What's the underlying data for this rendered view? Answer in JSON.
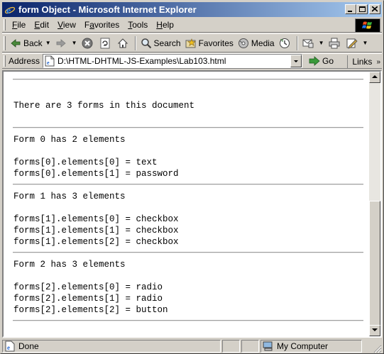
{
  "window": {
    "title": "form Object - Microsoft Internet Explorer"
  },
  "menu": {
    "items": [
      {
        "label": "File",
        "key": "F",
        "rest": "ile"
      },
      {
        "label": "Edit",
        "key": "E",
        "rest": "dit"
      },
      {
        "label": "View",
        "key": "V",
        "rest": "iew"
      },
      {
        "label": "Favorites",
        "key": "a",
        "pre": "F",
        "rest": "vorites"
      },
      {
        "label": "Tools",
        "key": "T",
        "rest": "ools"
      },
      {
        "label": "Help",
        "key": "H",
        "rest": "elp"
      }
    ]
  },
  "toolbar": {
    "back_label": "Back",
    "search_label": "Search",
    "favorites_label": "Favorites",
    "media_label": "Media"
  },
  "address": {
    "label": "Address",
    "value": "D:\\HTML-DHTML-JS-Examples\\Lab103.html",
    "go_label": "Go",
    "links_label": "Links"
  },
  "page": {
    "summary": "There are 3 forms in this document",
    "forms": [
      {
        "heading": "Form 0 has 2 elements",
        "elements": [
          "forms[0].elements[0] = text",
          "forms[0].elements[1] = password"
        ]
      },
      {
        "heading": "Form 1 has 3 elements",
        "elements": [
          "forms[1].elements[0] = checkbox",
          "forms[1].elements[1] = checkbox",
          "forms[1].elements[2] = checkbox"
        ]
      },
      {
        "heading": "Form 2 has 3 elements",
        "elements": [
          "forms[2].elements[0] = radio",
          "forms[2].elements[1] = radio",
          "forms[2].elements[2] = button"
        ]
      }
    ]
  },
  "status": {
    "text": "Done",
    "zone": "My Computer"
  }
}
